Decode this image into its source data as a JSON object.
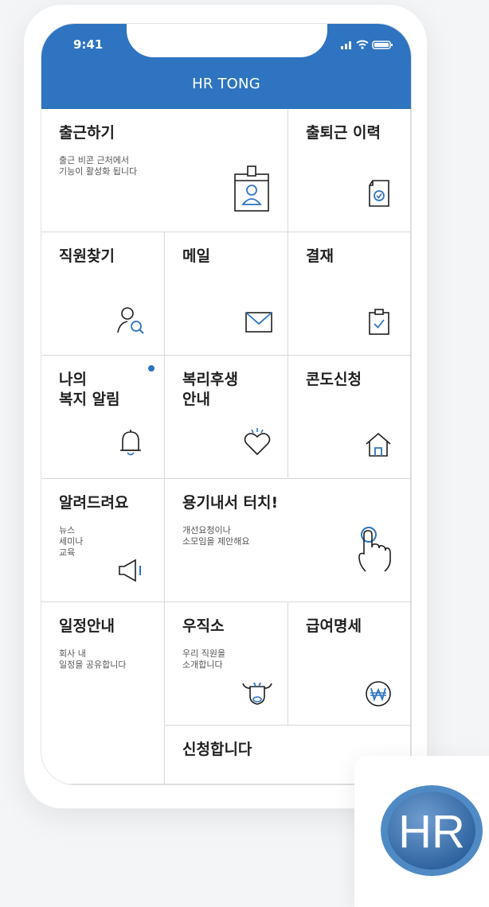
{
  "status_bar": {
    "time": "9:41"
  },
  "header": {
    "title": "HR TONG"
  },
  "grid": {
    "check_in": {
      "label": "출근하기",
      "desc": "출근 비콘 근처에서\n기능이 활성화 됩니다"
    },
    "attendance_history": {
      "label": "출퇴근 이력"
    },
    "find_employee": {
      "label": "직원찾기"
    },
    "mail": {
      "label": "메일"
    },
    "approval": {
      "label": "결재"
    },
    "my_welfare": {
      "label": "나의\n복지 알림"
    },
    "welfare_info": {
      "label": "복리후생\n안내"
    },
    "condo": {
      "label": "콘도신청"
    },
    "notice": {
      "label": "알려드려요",
      "desc": "뉴스\n세미나\n교육"
    },
    "brave_touch": {
      "label": "용기내서 터치!",
      "desc": "개선요청이나\n소모임을 제안해요"
    },
    "schedule": {
      "label": "일정안내",
      "desc": "회사 내\n일정을 공유합니다"
    },
    "post_office": {
      "label": "우직소",
      "desc": "우리 직원을\n소개합니다"
    },
    "payslip": {
      "label": "급여명세"
    },
    "apply": {
      "label": "신청합니다"
    }
  },
  "logo": {
    "text": "HR"
  },
  "colors": {
    "primary": "#2e74c0",
    "text": "#1f1f1f",
    "grid_line": "#d9d9d9"
  }
}
